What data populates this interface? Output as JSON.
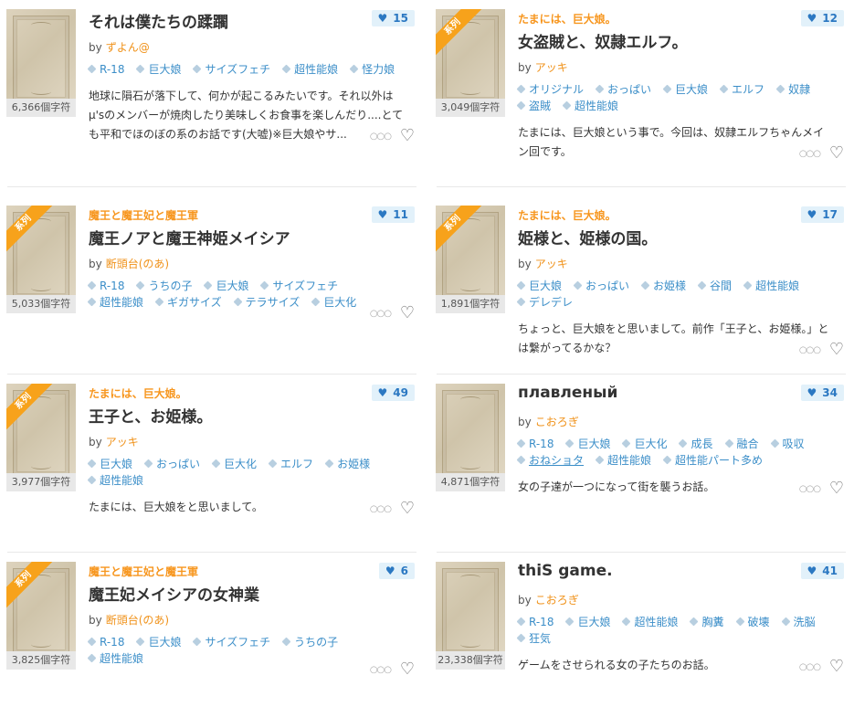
{
  "works": [
    {
      "series": "",
      "title": "それは僕たちの蹂躙",
      "likes": "15",
      "author": "ずよん@",
      "char_count": "6,366個字符",
      "is_series": false,
      "tags": [
        {
          "label": "R-18"
        },
        {
          "label": "巨大娘"
        },
        {
          "label": "サイズフェチ"
        },
        {
          "label": "超性能娘"
        },
        {
          "label": "怪力娘"
        }
      ],
      "description": "地球に隕石が落下して、何かが起こるみたいです。それ以外はμ'sのメンバーが焼肉したり美味しくお食事を楽しんだり....とても平和でほのぼの系のお話です(大嘘)※巨大娘やサ..."
    },
    {
      "series": "たまには、巨大娘。",
      "title": "女盗賊と、奴隷エルフ。",
      "likes": "12",
      "author": "アッキ",
      "char_count": "3,049個字符",
      "is_series": true,
      "tags": [
        {
          "label": "オリジナル"
        },
        {
          "label": "おっぱい"
        },
        {
          "label": "巨大娘"
        },
        {
          "label": "エルフ"
        },
        {
          "label": "奴隷"
        },
        {
          "label": "盗賊"
        },
        {
          "label": "超性能娘"
        }
      ],
      "description": "たまには、巨大娘という事で。今回は、奴隷エルフちゃんメイン回です。"
    },
    {
      "series": "魔王と魔王妃と魔王軍",
      "title": "魔王ノアと魔王神姫メイシア",
      "likes": "11",
      "author": "断頭台(のあ)",
      "char_count": "5,033個字符",
      "is_series": true,
      "tags": [
        {
          "label": "R-18"
        },
        {
          "label": "うちの子"
        },
        {
          "label": "巨大娘"
        },
        {
          "label": "サイズフェチ"
        },
        {
          "label": "超性能娘"
        },
        {
          "label": "ギガサイズ"
        },
        {
          "label": "テラサイズ"
        },
        {
          "label": "巨大化"
        }
      ],
      "description": ""
    },
    {
      "series": "たまには、巨大娘。",
      "title": "姫様と、姫様の国。",
      "likes": "17",
      "author": "アッキ",
      "char_count": "1,891個字符",
      "is_series": true,
      "tags": [
        {
          "label": "巨大娘"
        },
        {
          "label": "おっぱい"
        },
        {
          "label": "お姫様"
        },
        {
          "label": "谷間"
        },
        {
          "label": "超性能娘"
        },
        {
          "label": "デレデレ"
        }
      ],
      "description": "ちょっと、巨大娘をと思いまして。前作「王子と、お姫様。」とは繋がってるかな？"
    },
    {
      "series": "たまには、巨大娘。",
      "title": "王子と、お姫様。",
      "likes": "49",
      "author": "アッキ",
      "char_count": "3,977個字符",
      "is_series": true,
      "tags": [
        {
          "label": "巨大娘"
        },
        {
          "label": "おっぱい"
        },
        {
          "label": "巨大化"
        },
        {
          "label": "エルフ"
        },
        {
          "label": "お姫様"
        },
        {
          "label": "超性能娘"
        }
      ],
      "description": "たまには、巨大娘をと思いまして。"
    },
    {
      "series": "",
      "title": "плавленый",
      "likes": "34",
      "author": "こおろぎ",
      "char_count": "4,871個字符",
      "is_series": false,
      "tags": [
        {
          "label": "R-18"
        },
        {
          "label": "巨大娘"
        },
        {
          "label": "巨大化"
        },
        {
          "label": "成長"
        },
        {
          "label": "融合"
        },
        {
          "label": "吸収"
        },
        {
          "label": "おねショタ",
          "underline": true
        },
        {
          "label": "超性能娘"
        },
        {
          "label": "超性能パート多め"
        }
      ],
      "description": "女の子達が一つになって街を襲うお話。"
    },
    {
      "series": "魔王と魔王妃と魔王軍",
      "title": "魔王妃メイシアの女神業",
      "likes": "6",
      "author": "断頭台(のあ)",
      "char_count": "3,825個字符",
      "is_series": true,
      "tags": [
        {
          "label": "R-18"
        },
        {
          "label": "巨大娘"
        },
        {
          "label": "サイズフェチ"
        },
        {
          "label": "うちの子"
        },
        {
          "label": "超性能娘"
        }
      ],
      "description": ""
    },
    {
      "series": "",
      "title": "thiS game.",
      "likes": "41",
      "author": "こおろぎ",
      "char_count": "23,338個字符",
      "is_series": false,
      "tags": [
        {
          "label": "R-18"
        },
        {
          "label": "巨大娘"
        },
        {
          "label": "超性能娘"
        },
        {
          "label": "胸糞"
        },
        {
          "label": "破壊"
        },
        {
          "label": "洗脳"
        },
        {
          "label": "狂気"
        }
      ],
      "description": "ゲームをさせられる女の子たちのお話。"
    }
  ],
  "labels": {
    "by": "by",
    "series_ribbon": "系列",
    "more_icon": "○○○",
    "fav_icon": "♡",
    "like_icon": "♥"
  },
  "colors": {
    "accent_orange": "#f7961e",
    "link_blue": "#3b8ec8",
    "likes_bg": "#e2f1fa"
  }
}
